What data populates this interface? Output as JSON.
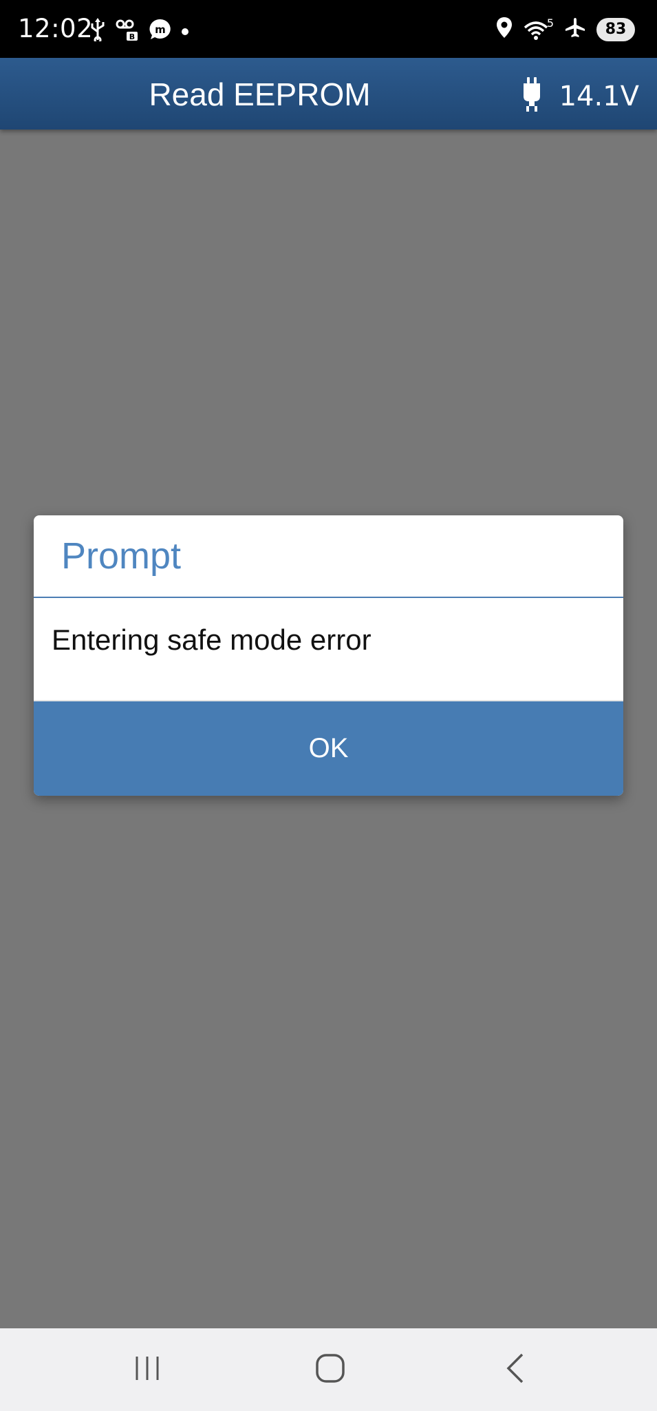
{
  "status_bar": {
    "time": "12:02",
    "wifi_label": "5",
    "battery": "83",
    "icons": [
      "usb-icon",
      "voicemail-icon",
      "messenger-icon",
      "notification-dot-icon",
      "location-icon",
      "wifi-icon",
      "airplane-icon",
      "battery-icon"
    ]
  },
  "header": {
    "title": "Read EEPROM",
    "voltage": "14.1V",
    "voltage_icon": "plug-icon"
  },
  "dialog": {
    "title": "Prompt",
    "message": "Entering safe mode error",
    "ok_label": "OK"
  },
  "nav_bar": {
    "icons": [
      "recent-apps-icon",
      "home-icon",
      "back-icon"
    ]
  },
  "colors": {
    "header_bg": "#2a5587",
    "dialog_title": "#4f86c0",
    "ok_button_bg": "#477cb3",
    "overlay_bg": "#787878"
  }
}
